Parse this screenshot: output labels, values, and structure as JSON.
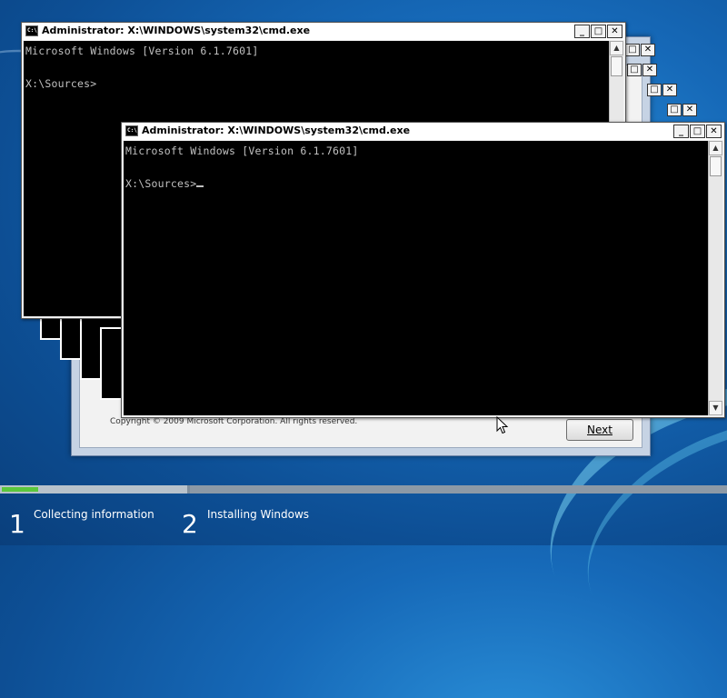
{
  "setup": {
    "copyright": "Copyright © 2009 Microsoft Corporation. All rights reserved.",
    "next_label": "Next"
  },
  "cmd": {
    "title": "Administrator: X:\\WINDOWS\\system32\\cmd.exe",
    "icon_text": "C:\\.",
    "version_line": "Microsoft Windows [Version 6.1.7601]",
    "prompt": "X:\\Sources>"
  },
  "window_buttons": {
    "minimize": "_",
    "maximize": "□",
    "close": "✕"
  },
  "progress": {
    "current_step_fraction": 0.05,
    "steps": [
      {
        "number": "1",
        "label": "Collecting information"
      },
      {
        "number": "2",
        "label": "Installing Windows"
      }
    ]
  },
  "colors": {
    "console_bg": "#000000",
    "console_text": "#c0c0c0",
    "progress_green": "#5ac73c"
  }
}
